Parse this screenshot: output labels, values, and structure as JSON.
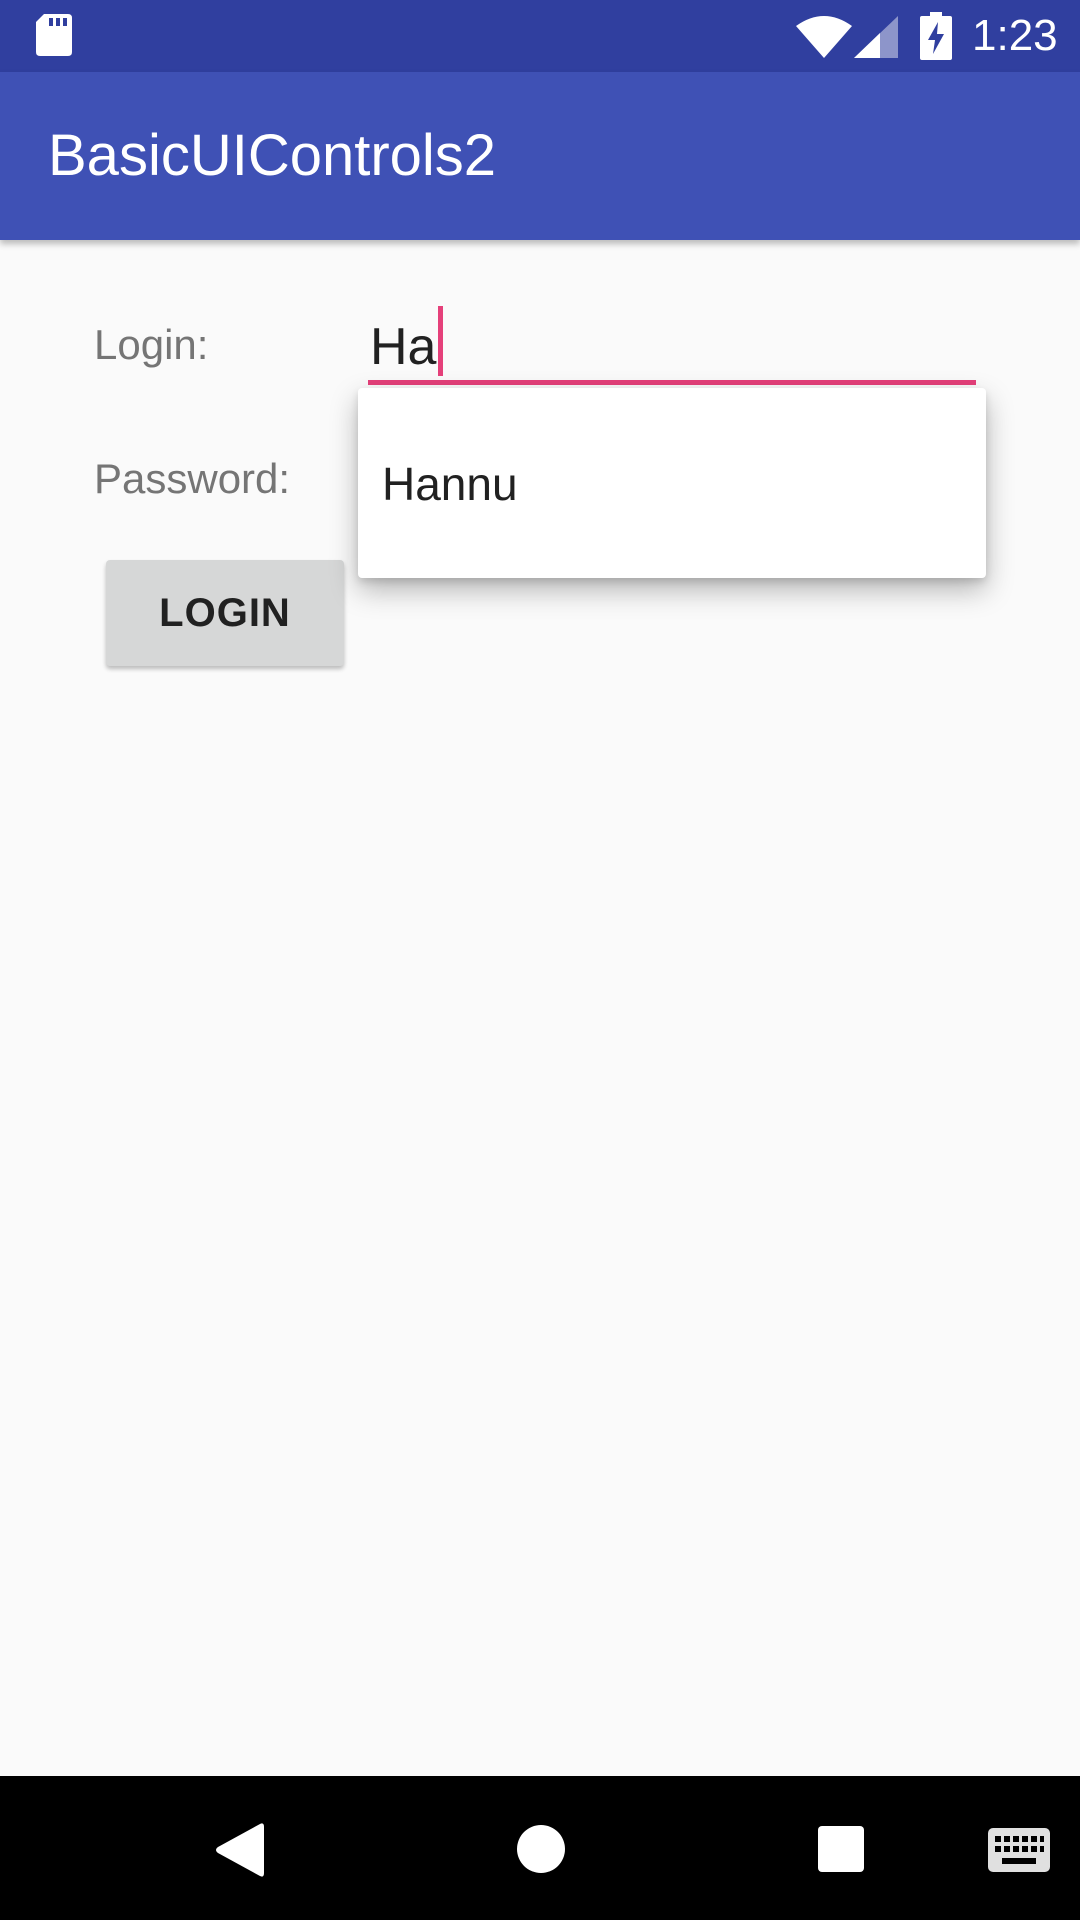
{
  "status_bar": {
    "time": "1:23",
    "icons": [
      "sd-card-icon",
      "wifi-icon",
      "signal-icon",
      "battery-charging-icon"
    ],
    "background_color": "#303f9f"
  },
  "app_bar": {
    "title": "BasicUIControls2",
    "background_color": "#3f51b5"
  },
  "form": {
    "login_label": "Login:",
    "login_value": "Ha",
    "password_label": "Password:",
    "login_button_label": "LOGIN",
    "accent_color": "#e5407a"
  },
  "autocomplete": {
    "suggestions": [
      "Hannu"
    ]
  },
  "nav_bar": {
    "icons": [
      "back-icon",
      "home-icon",
      "recents-icon",
      "keyboard-icon"
    ]
  }
}
